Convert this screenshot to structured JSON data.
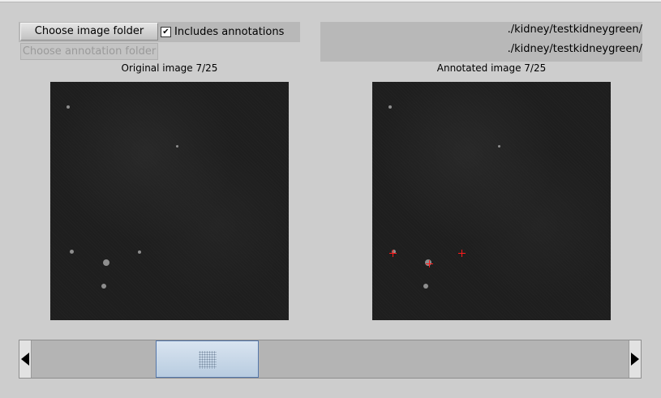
{
  "controls": {
    "choose_image_folder": "Choose image folder",
    "includes_annotations": "Includes annotations",
    "includes_annotations_checked": true,
    "choose_annotation_folder": "Choose annotation folder"
  },
  "paths": {
    "image_folder": "./kidney/testkidneygreen/",
    "annotation_folder": "./kidney/testkidneygreen/"
  },
  "captions": {
    "original": "Original image  7/25",
    "annotated": "Annotated image  7/25"
  },
  "navigation": {
    "current_image": 7,
    "total_images": 25
  },
  "colors": {
    "background": "#cdcdcd",
    "marker": "#ff1a1a",
    "scroll_thumb": "#c8d8ea"
  }
}
